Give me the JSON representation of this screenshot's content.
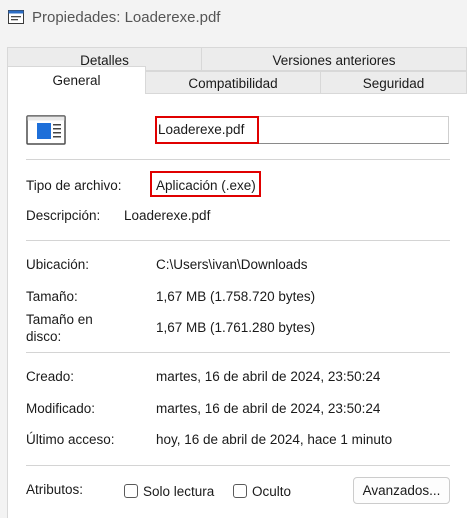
{
  "window": {
    "title": "Propiedades: Loaderexe.pdf"
  },
  "tabs_row1": [
    {
      "label": "Detalles"
    },
    {
      "label": "Versiones anteriores"
    }
  ],
  "tabs_row2": [
    {
      "label": "General",
      "active": true
    },
    {
      "label": "Compatibilidad"
    },
    {
      "label": "Seguridad"
    }
  ],
  "general": {
    "file_name": "Loaderexe.pdf",
    "file_type_label": "Tipo de archivo:",
    "file_type_value": "Aplicación (.exe)",
    "description_label": "Descripción:",
    "description_value": "Loaderexe.pdf",
    "location_label": "Ubicación:",
    "location_value": "C:\\Users\\ivan\\Downloads",
    "size_label": "Tamaño:",
    "size_value": "1,67 MB (1.758.720 bytes)",
    "size_on_disk_label_1": "Tamaño en",
    "size_on_disk_label_2": "disco:",
    "size_on_disk_value": "1,67 MB (1.761.280 bytes)",
    "created_label": "Creado:",
    "created_value": "martes, 16 de abril de 2024, 23:50:24",
    "modified_label": "Modificado:",
    "modified_value": "martes, 16 de abril de 2024, 23:50:24",
    "accessed_label": "Último acceso:",
    "accessed_value": "hoy, 16 de abril de 2024, hace 1 minuto",
    "attributes_label": "Atributos:",
    "readonly_label": "Solo lectura",
    "hidden_label": "Oculto",
    "advanced_button": "Avanzados..."
  },
  "highlight_color": "#e00000"
}
